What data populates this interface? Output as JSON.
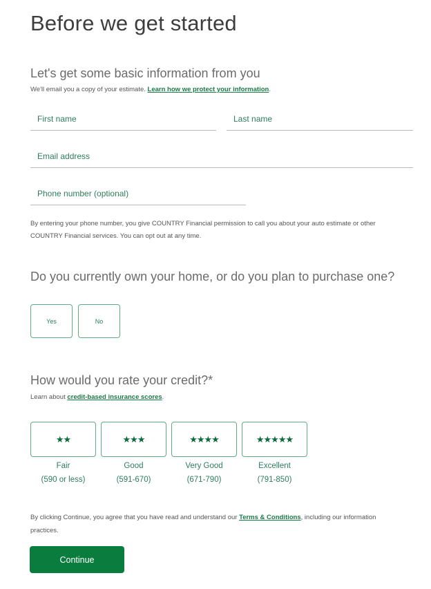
{
  "page_title": "Before we get started",
  "basic_info": {
    "heading": "Let's get some basic information from you",
    "note_prefix": "We'll email you a copy of your estimate. ",
    "note_link": "Learn how we protect your information",
    "note_suffix": "."
  },
  "fields": {
    "first_name": {
      "placeholder": "First name",
      "value": ""
    },
    "last_name": {
      "placeholder": "Last name",
      "value": ""
    },
    "email": {
      "placeholder": "Email address",
      "value": ""
    },
    "phone": {
      "placeholder": "Phone number (optional)",
      "value": ""
    }
  },
  "phone_disclaimer": {
    "line1": "By entering your phone number, you give COUNTRY Financial permission to call you about your auto estimate or other",
    "line2": "COUNTRY Financial services. You can opt out at any time."
  },
  "home_question": {
    "heading": "Do you currently own your home, or do you plan to purchase one?",
    "options": [
      {
        "label": "Yes"
      },
      {
        "label": "No"
      }
    ]
  },
  "credit": {
    "heading": "How would you rate your credit?*",
    "note_prefix": "Learn about ",
    "note_link": "credit-based insurance scores",
    "note_suffix": ".",
    "options": [
      {
        "stars": "★★",
        "star_count": 2,
        "label": "Fair",
        "range": "(590 or less)"
      },
      {
        "stars": "★★★",
        "star_count": 3,
        "label": "Good",
        "range": "(591-670)"
      },
      {
        "stars": "★★★★",
        "star_count": 4,
        "label": "Very Good",
        "range": "(671-790)"
      },
      {
        "stars": "★★★★★",
        "star_count": 5,
        "label": "Excellent",
        "range": "(791-850)"
      }
    ]
  },
  "terms": {
    "prefix": "By clicking Continue, you agree that you have read and understand our ",
    "link": "Terms & Conditions",
    "suffix": ", including our information",
    "line2": "practices."
  },
  "continue_label": "Continue",
  "colors": {
    "accent": "#0a7c3e",
    "link": "#1a7a45",
    "border_green": "#5fab84"
  }
}
